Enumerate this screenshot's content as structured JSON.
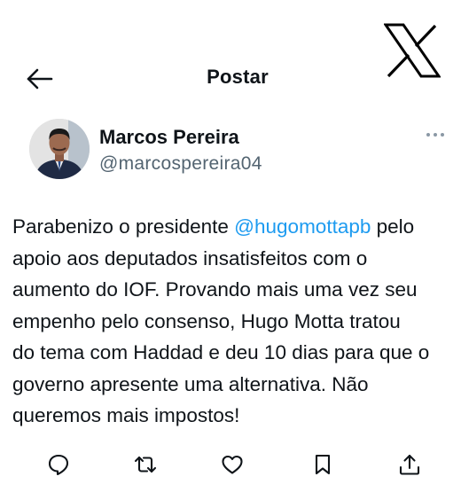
{
  "header": {
    "title": "Postar",
    "back_icon": "arrow-left-icon",
    "brand_icon": "x-logo-icon"
  },
  "author": {
    "name": "Marcos Pereira",
    "handle": "@marcospereira04",
    "avatar": "avatar"
  },
  "post": {
    "line1_prefix": "Parabenizo o presidente ",
    "mention": "@hugomottapb",
    "line1_suffix": " pelo",
    "lines": [
      "apoio aos deputados insatisfeitos com o",
      "aumento do IOF. Provando mais uma vez seu",
      "empenho pelo consenso, Hugo Motta tratou",
      "do tema com Haddad e deu 10 dias para que o",
      "governo apresente uma alternativa. Não",
      "queremos mais impostos!"
    ]
  },
  "actions": [
    "reply-icon",
    "repost-icon",
    "like-icon",
    "bookmark-icon",
    "share-icon"
  ],
  "colors": {
    "text": "#0f1419",
    "secondary": "#536471",
    "link": "#1d9bf0"
  }
}
